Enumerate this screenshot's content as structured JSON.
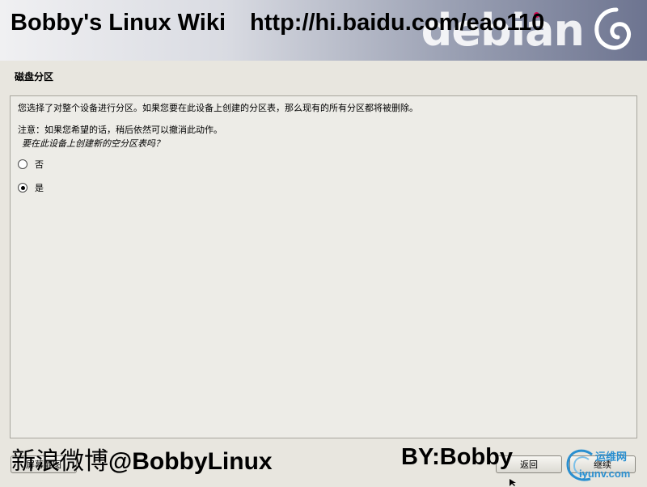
{
  "banner": {
    "overlay_title": "Bobby's Linux Wiki",
    "overlay_url": "http://hi.baidu.com/eao110",
    "logo_text": "debian"
  },
  "page": {
    "title": "磁盘分区"
  },
  "content": {
    "description": "您选择了对整个设备进行分区。如果您要在此设备上创建的分区表，那么现有的所有分区都将被删除。",
    "note": "注意：如果您希望的话，稍后依然可以撤消此动作。",
    "question": "要在此设备上创建新的空分区表吗？",
    "options": [
      {
        "label": "否",
        "selected": false
      },
      {
        "label": "是",
        "selected": true
      }
    ]
  },
  "buttons": {
    "screenshot": "屏幕截图",
    "back": "返回",
    "continue": "继续"
  },
  "watermarks": {
    "weibo_prefix": "新浪微博",
    "weibo_handle": "@BobbyLinux",
    "by": "BY:Bobby",
    "site_cn": "运维网",
    "site_en": "iyunv.com"
  },
  "colors": {
    "debian_red": "#d70751",
    "background": "#e8e6df",
    "site_logo_blue": "#2a8fd0"
  }
}
